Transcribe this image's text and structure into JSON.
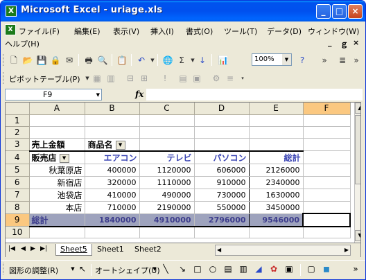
{
  "window": {
    "title": "Microsoft Excel - uriage.xls",
    "app_icon_glyph": "X",
    "minimize_glyph": "_",
    "maximize_glyph": "□",
    "close_glyph": "×"
  },
  "menu": {
    "items": [
      "ファイル(F)",
      "編集(E)",
      "表示(V)",
      "挿入(I)",
      "書式(O)",
      "ツール(T)",
      "データ(D)",
      "ウィンドウ(W)"
    ],
    "help": "ヘルプ(H)",
    "doc_controls": [
      "_",
      "♂",
      "×"
    ]
  },
  "toolbar": {
    "zoom": "100%",
    "pivot_label": "ピボットテーブル(P)"
  },
  "formula_bar": {
    "name_box": "F9",
    "fx": "fx",
    "formula": ""
  },
  "grid": {
    "columns": [
      "A",
      "B",
      "C",
      "D",
      "E",
      "F"
    ],
    "rows": [
      {
        "n": "1",
        "cells": [
          "",
          "",
          "",
          "",
          "",
          ""
        ]
      },
      {
        "n": "2",
        "cells": [
          "",
          "",
          "",
          "",
          "",
          ""
        ]
      },
      {
        "n": "3",
        "cells": [
          "売上金額",
          "商品名",
          "",
          "",
          "",
          ""
        ]
      },
      {
        "n": "4",
        "cells": [
          "販売店",
          "エアコン",
          "テレビ",
          "パソコン",
          "総計",
          ""
        ]
      },
      {
        "n": "5",
        "cells": [
          "秋葉原店",
          "400000",
          "1120000",
          "606000",
          "2126000",
          ""
        ]
      },
      {
        "n": "6",
        "cells": [
          "新宿店",
          "320000",
          "1110000",
          "910000",
          "2340000",
          ""
        ]
      },
      {
        "n": "7",
        "cells": [
          "池袋店",
          "410000",
          "490000",
          "730000",
          "1630000",
          ""
        ]
      },
      {
        "n": "8",
        "cells": [
          "本店",
          "710000",
          "2190000",
          "550000",
          "3450000",
          ""
        ]
      },
      {
        "n": "9",
        "cells": [
          "総計",
          "1840000",
          "4910000",
          "2796000",
          "9546000",
          ""
        ]
      },
      {
        "n": "10",
        "cells": [
          "",
          "",
          "",
          "",
          "",
          ""
        ]
      }
    ]
  },
  "tabs": {
    "sheets": [
      "Sheet5",
      "Sheet1",
      "Sheet2"
    ],
    "active": "Sheet5"
  },
  "drawing": {
    "adjust_label": "図形の調整(R)",
    "autoshape_label": "オートシェイプ(U)"
  }
}
